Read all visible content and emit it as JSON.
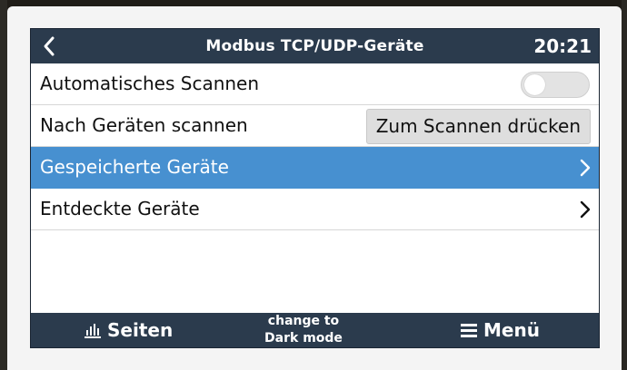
{
  "header": {
    "title": "Modbus TCP/UDP-Geräte",
    "time": "20:21",
    "back_icon": "chevron-left-icon"
  },
  "list": {
    "auto_scan": {
      "label": "Automatisches Scannen",
      "toggle_on": false
    },
    "scan_devices": {
      "label": "Nach Geräten scannen",
      "button_label": "Zum Scannen drücken"
    },
    "saved_devices": {
      "label": "Gespeicherte Geräte",
      "selected": true,
      "icon": "chevron-right-icon"
    },
    "discovered_devices": {
      "label": "Entdeckte Geräte",
      "icon": "chevron-right-icon"
    }
  },
  "footer": {
    "pages_label": "Seiten",
    "pages_icon": "bar-chart-icon",
    "dark_mode_line1": "change to",
    "dark_mode_line2": "Dark mode",
    "menu_label": "Menü",
    "menu_icon": "hamburger-menu-icon"
  },
  "colors": {
    "header_bg": "#2b3b4d",
    "selected_row": "#4790d0",
    "text": "#111111",
    "toggle_off": "#e3e3e3"
  }
}
